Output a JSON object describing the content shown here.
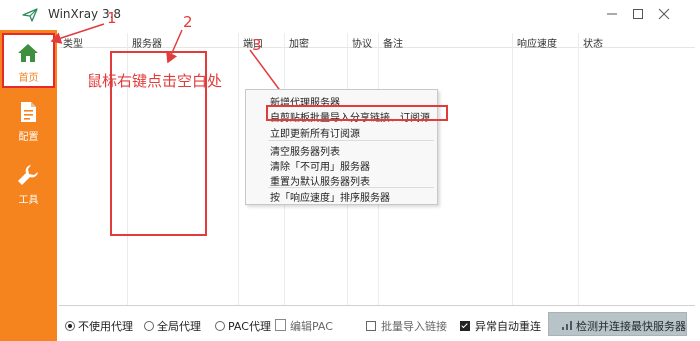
{
  "app": {
    "title": "WinXray 3.8",
    "accent": "#f5841f"
  },
  "window_controls": [
    "minimize-icon",
    "maximize-icon",
    "close-icon"
  ],
  "sidebar": {
    "items": [
      {
        "label": "首页",
        "icon": "home-icon",
        "active": true
      },
      {
        "label": "配置",
        "icon": "document-icon"
      },
      {
        "label": "工具",
        "icon": "wrench-icon"
      }
    ]
  },
  "table": {
    "columns": [
      "类型",
      "服务器",
      "端口",
      "加密",
      "协议",
      "备注",
      "响应速度",
      "状态"
    ],
    "rows": []
  },
  "annotations": {
    "instruction": "鼠标右键点击空白处",
    "step1": "1",
    "step2": "2",
    "step3": "3",
    "color": "#e23b3b"
  },
  "context_menu": {
    "items": [
      "新增代理服务器",
      "自剪贴板批量导入分享链接、订阅源",
      "立即更新所有订阅源",
      "清空服务器列表",
      "清除「不可用」服务器",
      "重置为默认服务器列表",
      "按「响应速度」排序服务器"
    ],
    "highlighted_index": 1
  },
  "bottom_bar": {
    "no_proxy": "不使用代理",
    "global_proxy": "全局代理",
    "pac_proxy": "PAC代理",
    "edit_pac": "编辑PAC",
    "batch_import": "批量导入链接",
    "auto_reconnect": "异常自动重连",
    "detect_button": "检测并连接最快服务器",
    "selected_mode": "no_proxy",
    "auto_reconnect_checked": true,
    "batch_import_checked": false
  }
}
